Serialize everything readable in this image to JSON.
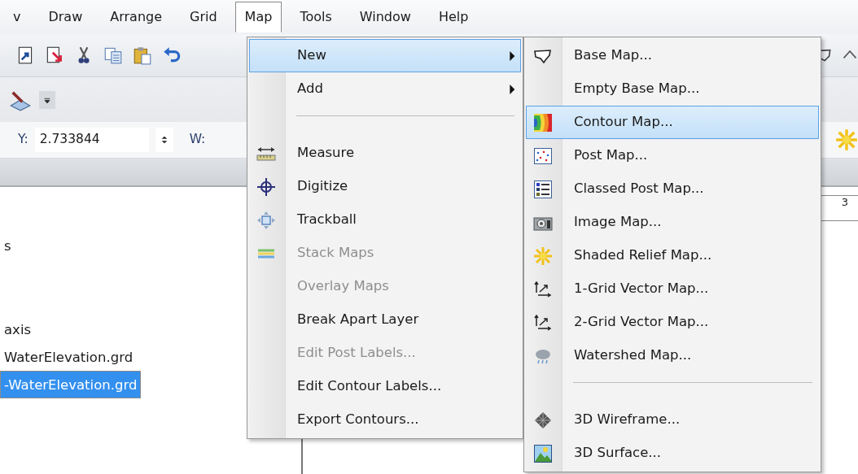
{
  "menubar": [
    {
      "label": "v",
      "selected": false
    },
    {
      "label": "Draw",
      "selected": false
    },
    {
      "label": "Arrange",
      "selected": false
    },
    {
      "label": "Grid",
      "selected": false
    },
    {
      "label": "Map",
      "selected": true
    },
    {
      "label": "Tools",
      "selected": false
    },
    {
      "label": "Window",
      "selected": false
    },
    {
      "label": "Help",
      "selected": false
    }
  ],
  "position_bar": {
    "y_label": "Y:",
    "y_value": "2.733844",
    "w_label": "W:"
  },
  "object_tree": [
    {
      "label": "s",
      "selected": false
    },
    {
      "label": "axis",
      "selected": false
    },
    {
      "label": "WaterElevation.grd",
      "selected": false
    },
    {
      "label": "-WaterElevation.grd",
      "selected": true
    }
  ],
  "ruler_label": "3",
  "map_menu": {
    "items": [
      {
        "kind": "item",
        "label": "New",
        "submenu": true,
        "selected": true,
        "disabled": false
      },
      {
        "kind": "item",
        "label": "Add",
        "submenu": true,
        "selected": false,
        "disabled": false
      },
      {
        "kind": "separator"
      },
      {
        "kind": "item",
        "label": "Measure",
        "submenu": false,
        "selected": false,
        "disabled": false
      },
      {
        "kind": "item",
        "label": "Digitize",
        "submenu": false,
        "selected": false,
        "disabled": false
      },
      {
        "kind": "item",
        "label": "Trackball",
        "submenu": false,
        "selected": false,
        "disabled": false
      },
      {
        "kind": "item",
        "label": "Stack Maps",
        "submenu": false,
        "selected": false,
        "disabled": true
      },
      {
        "kind": "item",
        "label": "Overlay Maps",
        "submenu": false,
        "selected": false,
        "disabled": true
      },
      {
        "kind": "item",
        "label": "Break Apart Layer",
        "submenu": false,
        "selected": false,
        "disabled": false
      },
      {
        "kind": "item",
        "label": "Edit Post Labels...",
        "submenu": false,
        "selected": false,
        "disabled": true
      },
      {
        "kind": "item",
        "label": "Edit Contour Labels...",
        "submenu": false,
        "selected": false,
        "disabled": false
      },
      {
        "kind": "item",
        "label": "Export Contours...",
        "submenu": false,
        "selected": false,
        "disabled": false
      }
    ]
  },
  "new_submenu": {
    "items": [
      {
        "kind": "item",
        "label": "Base Map...",
        "selected": false
      },
      {
        "kind": "item",
        "label": "Empty Base Map...",
        "selected": false
      },
      {
        "kind": "item",
        "label": "Contour Map...",
        "selected": true
      },
      {
        "kind": "item",
        "label": "Post Map...",
        "selected": false
      },
      {
        "kind": "item",
        "label": "Classed Post Map...",
        "selected": false
      },
      {
        "kind": "item",
        "label": "Image Map...",
        "selected": false
      },
      {
        "kind": "item",
        "label": "Shaded Relief Map...",
        "selected": false
      },
      {
        "kind": "item",
        "label": "1-Grid Vector Map...",
        "selected": false
      },
      {
        "kind": "item",
        "label": "2-Grid Vector Map...",
        "selected": false
      },
      {
        "kind": "item",
        "label": "Watershed Map...",
        "selected": false
      },
      {
        "kind": "separator"
      },
      {
        "kind": "item",
        "label": "3D Wireframe...",
        "selected": false
      },
      {
        "kind": "item",
        "label": "3D Surface...",
        "selected": false
      }
    ]
  }
}
